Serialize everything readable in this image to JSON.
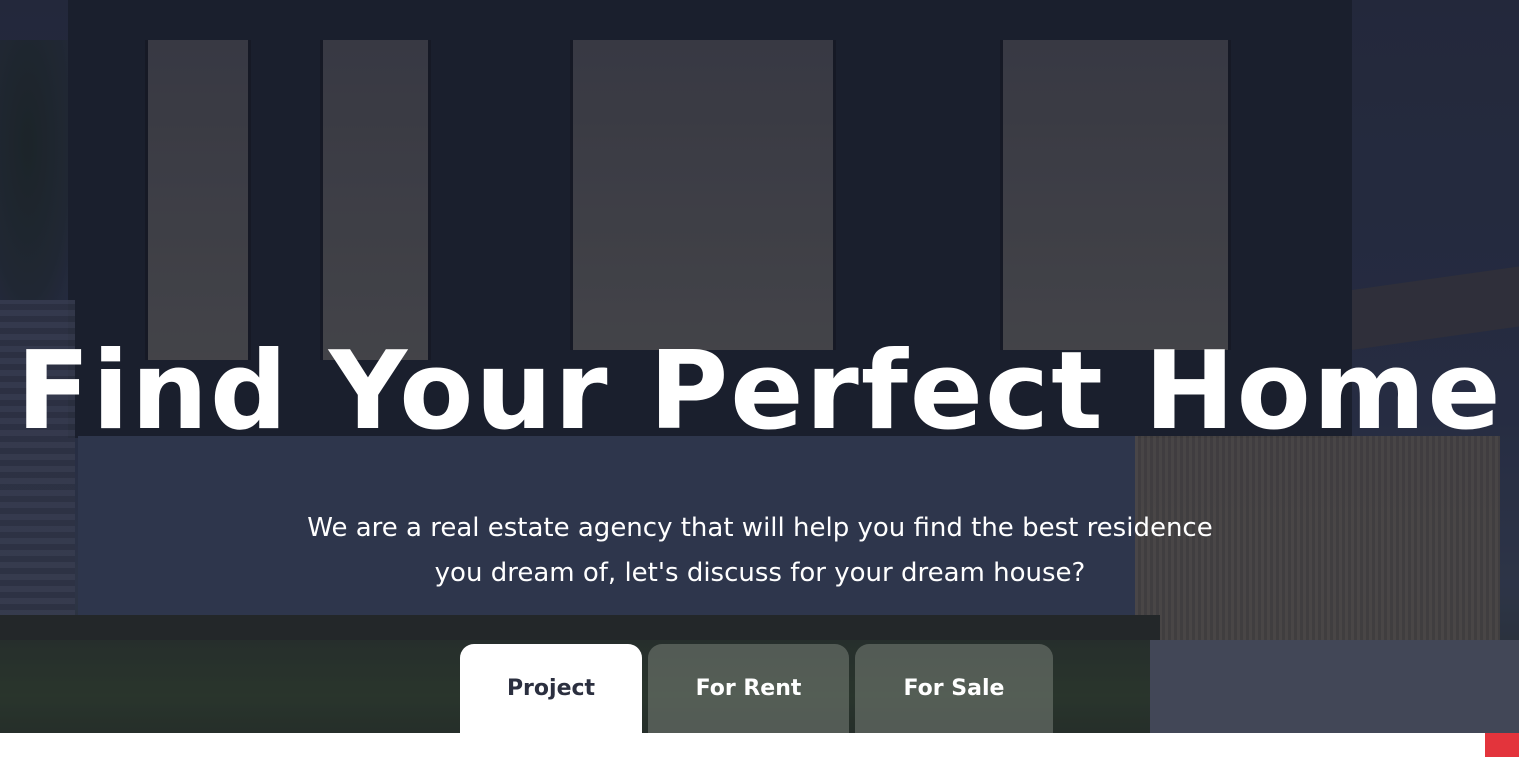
{
  "hero": {
    "title": "Find Your Perfect Home",
    "subtitle": "We are a real estate agency that will help you find the best residence you dream of, let's discuss for your dream house?"
  },
  "tabs": [
    {
      "label": "Project",
      "active": true
    },
    {
      "label": "For Rent",
      "active": false
    },
    {
      "label": "For Sale",
      "active": false
    }
  ],
  "colors": {
    "accent": "#e3343c",
    "active_tab_bg": "#ffffff",
    "active_tab_text": "#2b2f3f",
    "inactive_tab_bg": "rgba(120,128,120,0.55)",
    "hero_text": "#ffffff"
  }
}
